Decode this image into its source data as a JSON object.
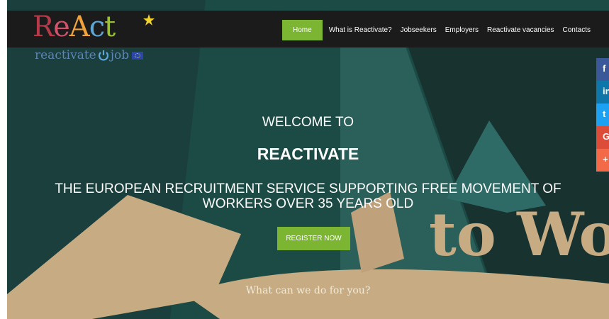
{
  "brand": {
    "logo_letters": [
      "R",
      "e",
      "A",
      "c",
      "t"
    ],
    "logo_tagline_left": "reactivate",
    "logo_tagline_right": "job"
  },
  "nav": {
    "items": [
      {
        "label": "Home",
        "active": true
      },
      {
        "label": "What is Reactivate?",
        "active": false
      },
      {
        "label": "Jobseekers",
        "active": false
      },
      {
        "label": "Employers",
        "active": false
      },
      {
        "label": "Reactivate vacancies",
        "active": false
      },
      {
        "label": "Contacts",
        "active": false
      }
    ]
  },
  "hero": {
    "welcome": "WELCOME TO",
    "title": "REACTIVATE",
    "subtitle": "THE EUROPEAN RECRUITMENT SERVICE SUPPORTING FREE MOVEMENT OF WORKERS OVER 35 YEARS OLD",
    "register_label": "REGISTER NOW",
    "poster_text": "to Work",
    "what_label": "What can we do for you?"
  },
  "share": [
    {
      "icon": "facebook-icon",
      "glyph": "f",
      "color": "#3b5998"
    },
    {
      "icon": "linkedin-icon",
      "glyph": "in",
      "color": "#0e76a8"
    },
    {
      "icon": "twitter-icon",
      "glyph": "t",
      "color": "#1da1f2"
    },
    {
      "icon": "google-plus-icon",
      "glyph": "G",
      "color": "#dd4b39"
    },
    {
      "icon": "more-plus-icon",
      "glyph": "+",
      "color": "#f26a47"
    }
  ],
  "colors": {
    "accent_green": "#7bb532",
    "topbar": "#1b1b1b",
    "hero_teal": "#1d4d48",
    "poster_tan": "#c7ab83"
  }
}
